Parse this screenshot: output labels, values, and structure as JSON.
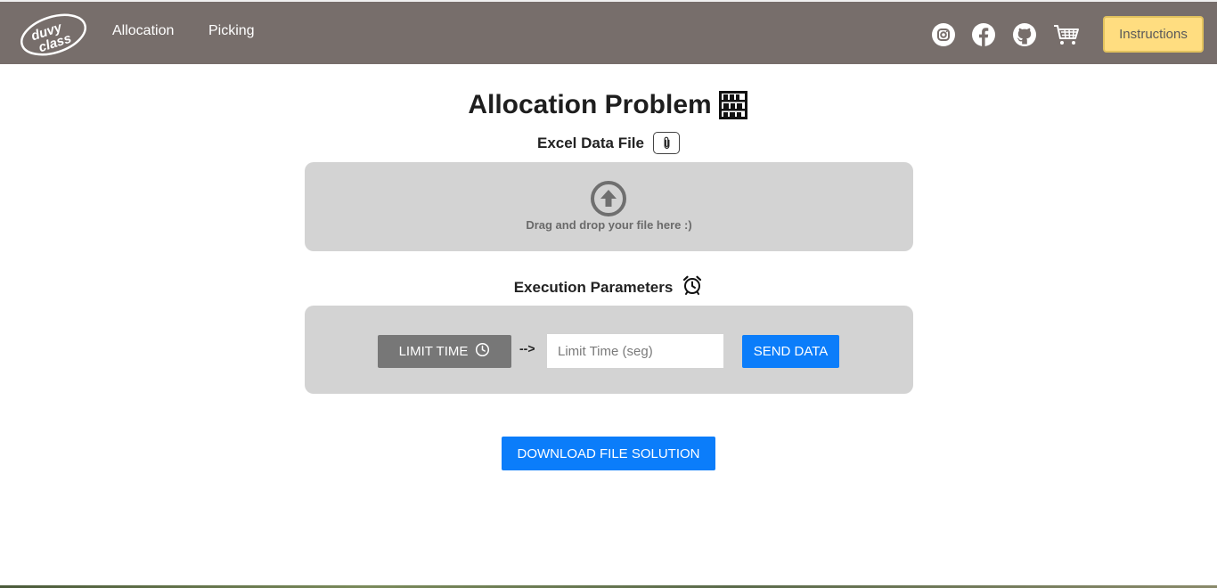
{
  "navbar": {
    "logo_text": "duvy class",
    "links": [
      "Allocation",
      "Picking"
    ],
    "social_icons": [
      "instagram-icon",
      "facebook-icon",
      "github-icon",
      "cart-icon"
    ],
    "instructions_label": "Instructions",
    "background_color": "#776e6b",
    "instructions_color": "#ffdd80"
  },
  "main": {
    "title": "Allocation Problem",
    "title_icon": "shelf-icon",
    "excel_section": {
      "label": "Excel Data File",
      "icon": "paperclip-icon"
    },
    "dropzone": {
      "icon": "upload-arrow-icon",
      "text": "Drag and drop your file here :)"
    },
    "exec_section": {
      "label": "Execution Parameters",
      "icon": "alarm-clock-icon"
    },
    "params": {
      "limit_label": "LIMIT TIME",
      "arrow": "-->",
      "input_placeholder": "Limit Time (seg)",
      "input_value": "",
      "send_label": "SEND DATA"
    },
    "download_label": "DOWNLOAD FILE SOLUTION",
    "accent_color": "#0b7dfa"
  }
}
